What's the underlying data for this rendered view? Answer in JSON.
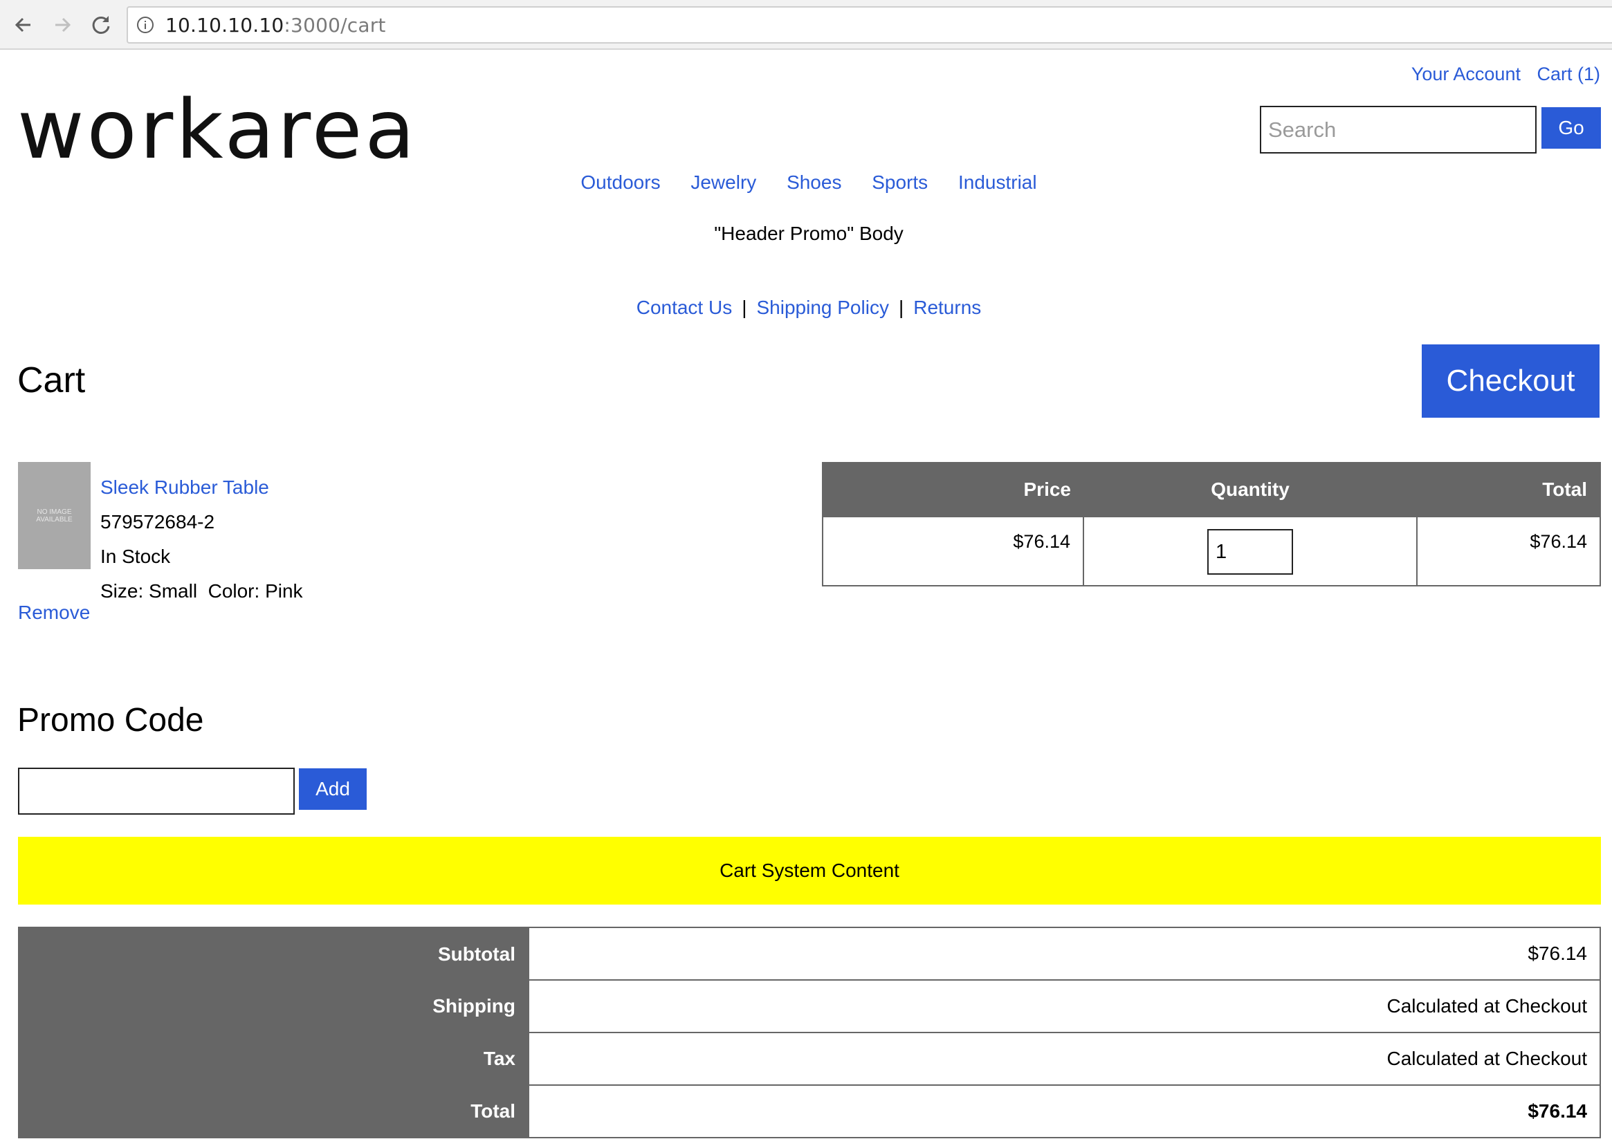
{
  "browser": {
    "url_host": "10.10.10.10",
    "url_path": ":3000/cart"
  },
  "header": {
    "account_link": "Your Account",
    "cart_link": "Cart (1)",
    "logo": "workarea",
    "search_placeholder": "Search",
    "search_button": "Go"
  },
  "nav": {
    "items": [
      "Outdoors",
      "Jewelry",
      "Shoes",
      "Sports",
      "Industrial"
    ]
  },
  "promo_banner": "\"Header Promo\" Body",
  "util_nav": {
    "items": [
      "Contact Us",
      "Shipping Policy",
      "Returns"
    ],
    "separator": "|"
  },
  "cart": {
    "title": "Cart",
    "checkout_button": "Checkout",
    "item": {
      "image_placeholder": "NO IMAGE AVAILABLE",
      "name": "Sleek Rubber Table",
      "sku": "579572684-2",
      "stock": "In Stock",
      "options": "Size: Small  Color: Pink",
      "remove": "Remove",
      "price": "$76.14",
      "quantity": "1",
      "total": "$76.14"
    },
    "table_headers": {
      "price": "Price",
      "quantity": "Quantity",
      "total": "Total"
    }
  },
  "promo_code": {
    "title": "Promo Code",
    "value": "",
    "button": "Add"
  },
  "system_content": "Cart System Content",
  "colors": {
    "accent": "#2a5bd7",
    "header_gray": "#666666",
    "system_content_bg": "#ffff00"
  },
  "summary": {
    "rows": [
      {
        "label": "Subtotal",
        "value": "$76.14"
      },
      {
        "label": "Shipping",
        "value": "Calculated at Checkout"
      },
      {
        "label": "Tax",
        "value": "Calculated at Checkout"
      },
      {
        "label": "Total",
        "value": "$76.14"
      }
    ]
  }
}
